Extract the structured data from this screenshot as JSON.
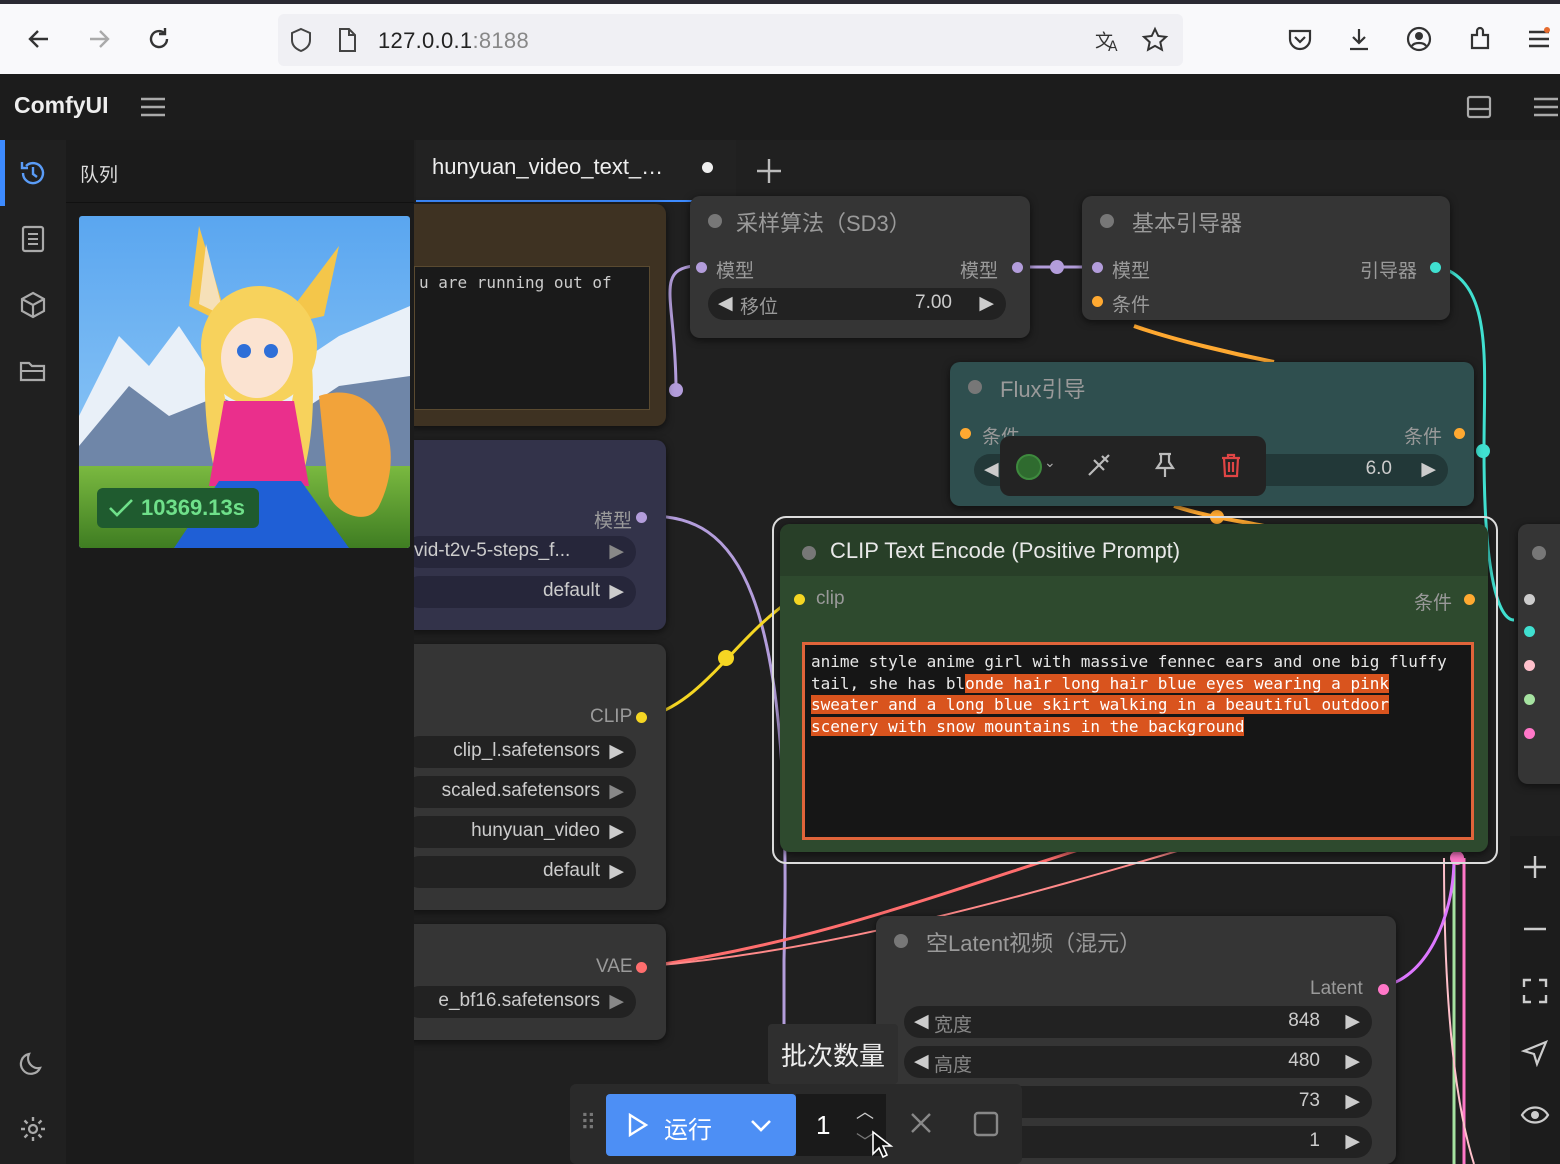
{
  "browser": {
    "url_host": "127.0.0.1",
    "url_port": ":8188"
  },
  "app": {
    "brand": "ComfyUI"
  },
  "queue": {
    "title": "队列",
    "item_time": "10369.13s"
  },
  "tab": {
    "label": "hunyuan_video_text_…"
  },
  "nodes": {
    "note_text": "u are running out of",
    "loader": {
      "model_label": "模型",
      "unet_value": "vid-t2v-5-steps_f...",
      "weight_dtype": "default"
    },
    "clip_loader": {
      "clip_label": "CLIP",
      "clip1": "clip_l.safetensors",
      "clip2": "scaled.safetensors",
      "type": "hunyuan_video",
      "device": "default"
    },
    "vae_loader": {
      "vae_label": "VAE",
      "vae_value": "e_bf16.safetensors"
    },
    "sampling_sd3": {
      "title": "采样算法（SD3）",
      "in_model": "模型",
      "out_model": "模型",
      "shift_label": "移位",
      "shift_value": "7.00"
    },
    "basic_guider": {
      "title": "基本引导器",
      "in_model": "模型",
      "in_cond": "条件",
      "out_guider": "引导器"
    },
    "flux_guidance": {
      "title": "Flux引导",
      "in_cond": "条件",
      "out_cond": "条件",
      "value": "6.0"
    },
    "clip_text": {
      "title": "CLIP Text Encode (Positive Prompt)",
      "in_clip": "clip",
      "out_cond": "条件",
      "text_plain": "anime style anime girl with massive fennec ears and one big fluffy tail, she has bl",
      "text_selected": "onde hair long hair blue eyes wearing a pink sweater and a long blue skirt walking in a beautiful outdoor scenery with snow mountains in the background"
    },
    "empty_latent": {
      "title": "空Latent视频（混元）",
      "out_latent": "Latent",
      "width_label": "宽度",
      "width_value": "848",
      "height_label": "高度",
      "height_value": "480",
      "length_value": "73",
      "batch_value": "1"
    }
  },
  "run": {
    "label": "运行",
    "batch_count": "1",
    "tooltip": "批次数量"
  },
  "colors": {
    "accent": "#4d8ff5",
    "clip_node": "#2e4a2e",
    "flux_node": "#2f4f4f",
    "link_clip": "#f5d623",
    "link_model": "#b39ddb",
    "link_vae": "#ff6e6e",
    "link_guider": "#40e0d0",
    "link_cond": "#ffa931"
  }
}
